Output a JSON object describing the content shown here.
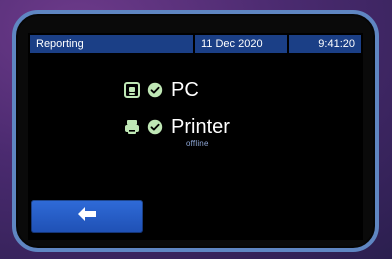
{
  "status_bar": {
    "title": "Reporting",
    "date": "11 Dec 2020",
    "time": "9:41:20"
  },
  "devices": [
    {
      "label": "PC",
      "icon": "pc-icon",
      "status_icon": "check-circle-icon",
      "status_text": ""
    },
    {
      "label": "Printer",
      "icon": "printer-icon",
      "status_icon": "check-circle-icon",
      "status_text": "offline"
    }
  ],
  "actions": {
    "back_icon": "arrow-left-icon"
  },
  "colors": {
    "status_bar_bg": "#1b3f86",
    "accent_blue": "#2f6bd8",
    "icon_green": "#bfe7b5",
    "bezel_border": "#5f86c2"
  }
}
